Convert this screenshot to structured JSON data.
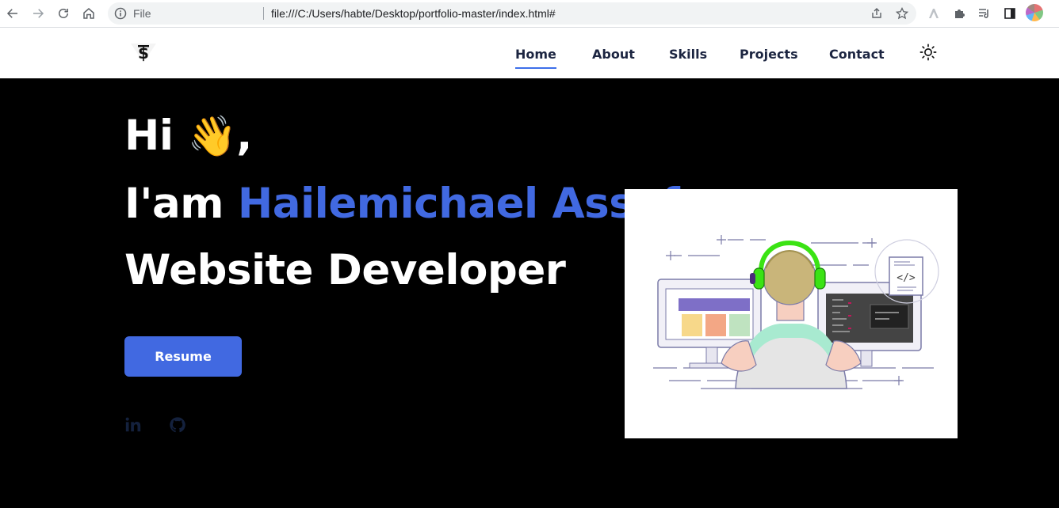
{
  "browser": {
    "file_label": "File",
    "url": "file:///C:/Users/habte/Desktop/portfolio-master/index.html#",
    "icons": [
      "back-icon",
      "forward-icon",
      "reload-icon",
      "home-icon",
      "info-icon",
      "share-icon",
      "star-icon",
      "extension-icon",
      "puzzle-icon",
      "media-icon",
      "sidepanel-icon",
      "profile-avatar"
    ]
  },
  "header": {
    "logo_alt": "logo",
    "nav": [
      {
        "label": "Home",
        "active": true
      },
      {
        "label": "About"
      },
      {
        "label": "Skills"
      },
      {
        "label": "Projects"
      },
      {
        "label": "Contact"
      }
    ],
    "theme_icon": "sun-icon"
  },
  "hero": {
    "greeting": "Hi",
    "wave": "👋",
    "comma": ",",
    "iam": "I'am",
    "name": "Hailemichael Assefa",
    "role": "Website Developer",
    "resume_label": "Resume",
    "socials": [
      "linkedin-icon",
      "github-icon"
    ],
    "illustration": "developer-at-desk-illustration"
  },
  "colors": {
    "accent": "#4169e1",
    "background": "#000000",
    "header": "#ffffff",
    "nav_text": "#1c2541"
  }
}
